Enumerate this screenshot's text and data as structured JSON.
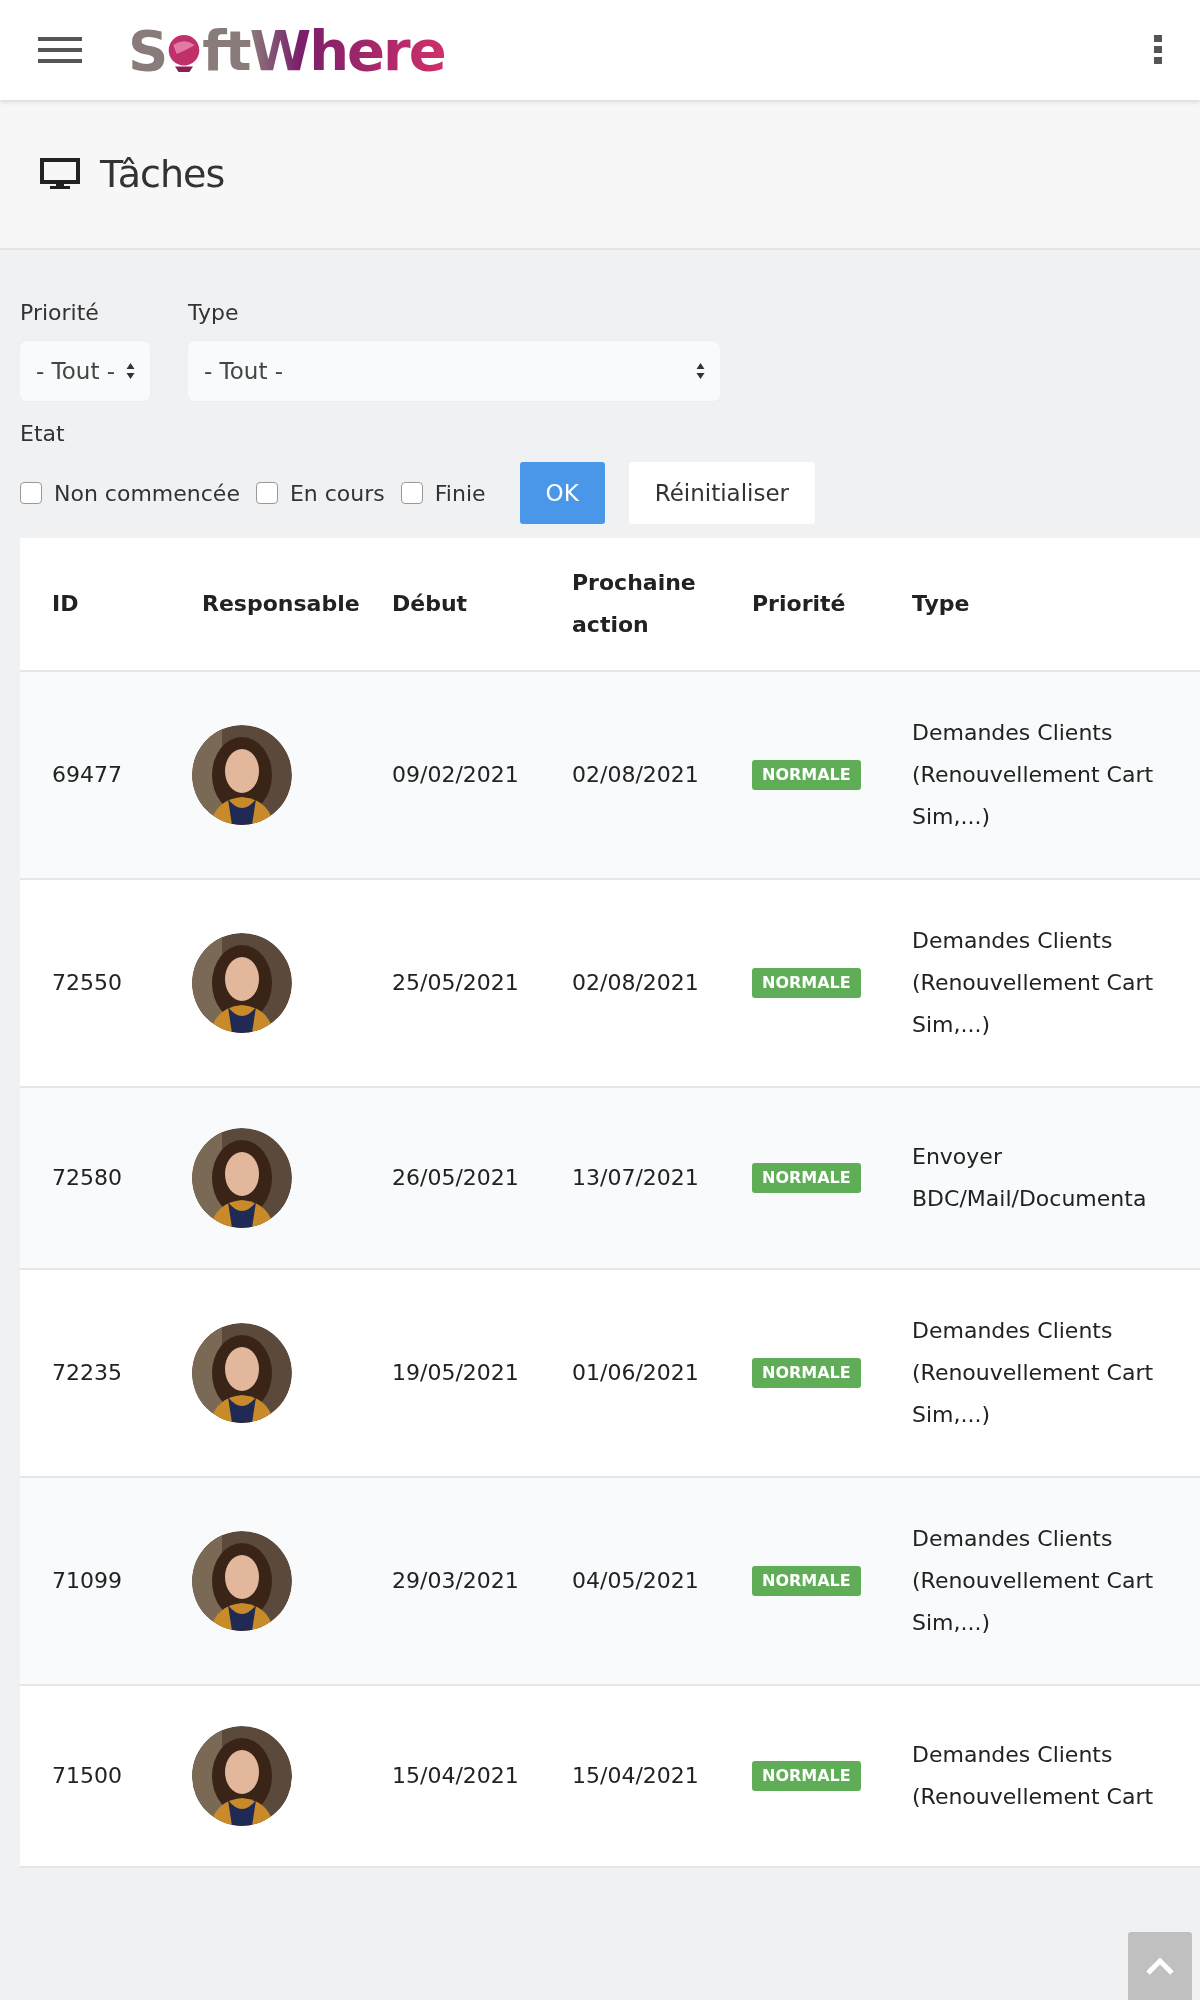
{
  "header": {
    "logo": {
      "part1": "S",
      "part2": "ftWhere"
    }
  },
  "page_title": "Tâches",
  "filters": {
    "priority": {
      "label": "Priorité",
      "value": "- Tout -"
    },
    "type": {
      "label": "Type",
      "value": "- Tout -"
    },
    "state_label": "Etat",
    "states": [
      {
        "label": "Non commencée",
        "checked": false
      },
      {
        "label": "En cours",
        "checked": false
      },
      {
        "label": "Finie",
        "checked": false
      }
    ],
    "buttons": [
      {
        "label": "OK",
        "kind": "primary"
      },
      {
        "label": "Réinitialiser",
        "kind": "default"
      }
    ]
  },
  "table": {
    "columns": [
      "ID",
      "Responsable",
      "Début",
      "Prochaine action",
      "Priorité",
      "Type"
    ],
    "rows": [
      {
        "id": "69477",
        "start": "09/02/2021",
        "next": "02/08/2021",
        "priority": "NORMALE",
        "type": [
          "Demandes Clients",
          "(Renouvellement Cart",
          "Sim,...)"
        ]
      },
      {
        "id": "72550",
        "start": "25/05/2021",
        "next": "02/08/2021",
        "priority": "NORMALE",
        "type": [
          "Demandes Clients",
          "(Renouvellement Cart",
          "Sim,...)"
        ]
      },
      {
        "id": "72580",
        "start": "26/05/2021",
        "next": "13/07/2021",
        "priority": "NORMALE",
        "type": [
          "Envoyer",
          "BDC/Mail/Documenta"
        ]
      },
      {
        "id": "72235",
        "start": "19/05/2021",
        "next": "01/06/2021",
        "priority": "NORMALE",
        "type": [
          "Demandes Clients",
          "(Renouvellement Cart",
          "Sim,...)"
        ]
      },
      {
        "id": "71099",
        "start": "29/03/2021",
        "next": "04/05/2021",
        "priority": "NORMALE",
        "type": [
          "Demandes Clients",
          "(Renouvellement Cart",
          "Sim,...)"
        ]
      },
      {
        "id": "71500",
        "start": "15/04/2021",
        "next": "15/04/2021",
        "priority": "NORMALE",
        "type": [
          "Demandes Clients",
          "(Renouvellement Cart"
        ]
      }
    ]
  }
}
